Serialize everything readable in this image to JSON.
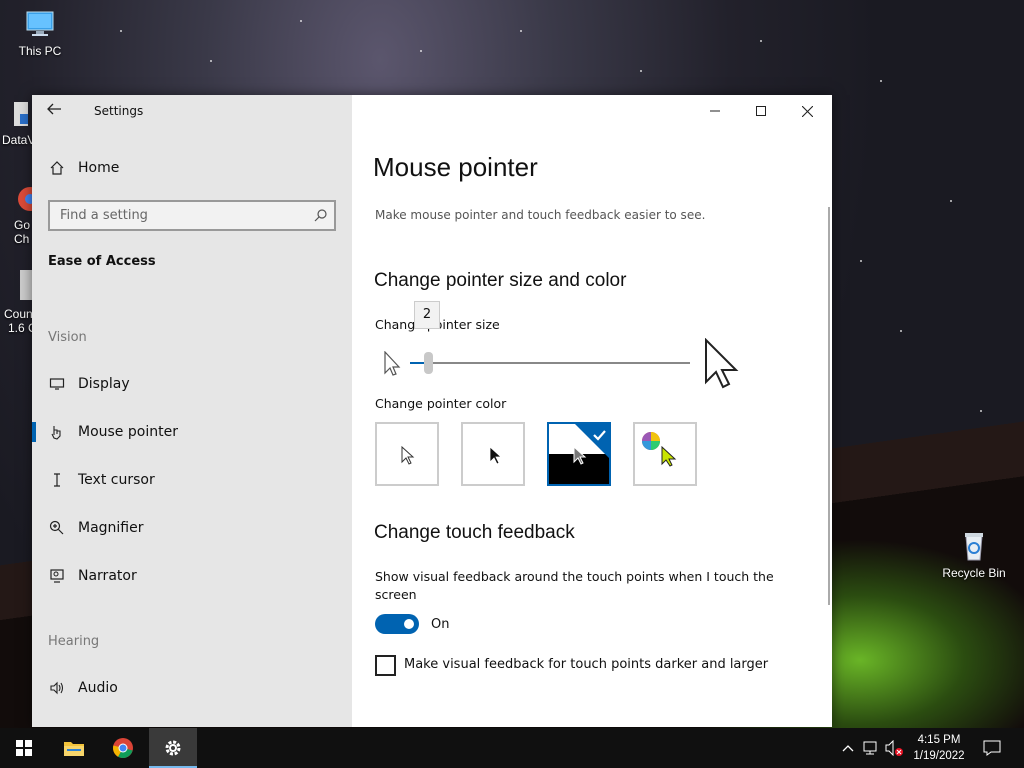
{
  "desktop": {
    "icons": [
      {
        "label": "This PC"
      },
      {
        "label": "Recycle Bin"
      }
    ],
    "partial_icons": [
      "DataV",
      "Go",
      "Ch",
      "Coun",
      "1.6 C"
    ]
  },
  "window": {
    "title": "Settings",
    "sidebar": {
      "home_label": "Home",
      "search_placeholder": "Find a setting",
      "section_title": "Ease of Access",
      "groups": [
        {
          "label": "Vision"
        },
        {
          "label": "Hearing"
        }
      ],
      "items": [
        {
          "label": "Display",
          "icon": "display-icon"
        },
        {
          "label": "Mouse pointer",
          "icon": "mouse-pointer-icon",
          "selected": true
        },
        {
          "label": "Text cursor",
          "icon": "text-cursor-icon"
        },
        {
          "label": "Magnifier",
          "icon": "magnifier-icon"
        },
        {
          "label": "Narrator",
          "icon": "narrator-icon"
        },
        {
          "label": "Audio",
          "icon": "audio-icon"
        }
      ]
    },
    "content": {
      "page_title": "Mouse pointer",
      "subtitle": "Make mouse pointer and touch feedback easier to see.",
      "size_color_heading": "Change pointer size and color",
      "pointer_size_label": "Change pointer size",
      "pointer_size_value": "2",
      "pointer_size_fraction": 0.07,
      "pointer_color_label": "Change pointer color",
      "color_options": [
        {
          "name": "white"
        },
        {
          "name": "black"
        },
        {
          "name": "inverted",
          "selected": true
        },
        {
          "name": "custom"
        }
      ],
      "touch_heading": "Change touch feedback",
      "touch_description": "Show visual feedback around the touch points when I touch the screen",
      "toggle_state": "On",
      "checkbox_label": "Make visual feedback for touch points darker and larger",
      "checkbox_checked": false
    }
  },
  "taskbar": {
    "time": "4:15 PM",
    "date": "1/19/2022",
    "accent": "#0063b1"
  }
}
